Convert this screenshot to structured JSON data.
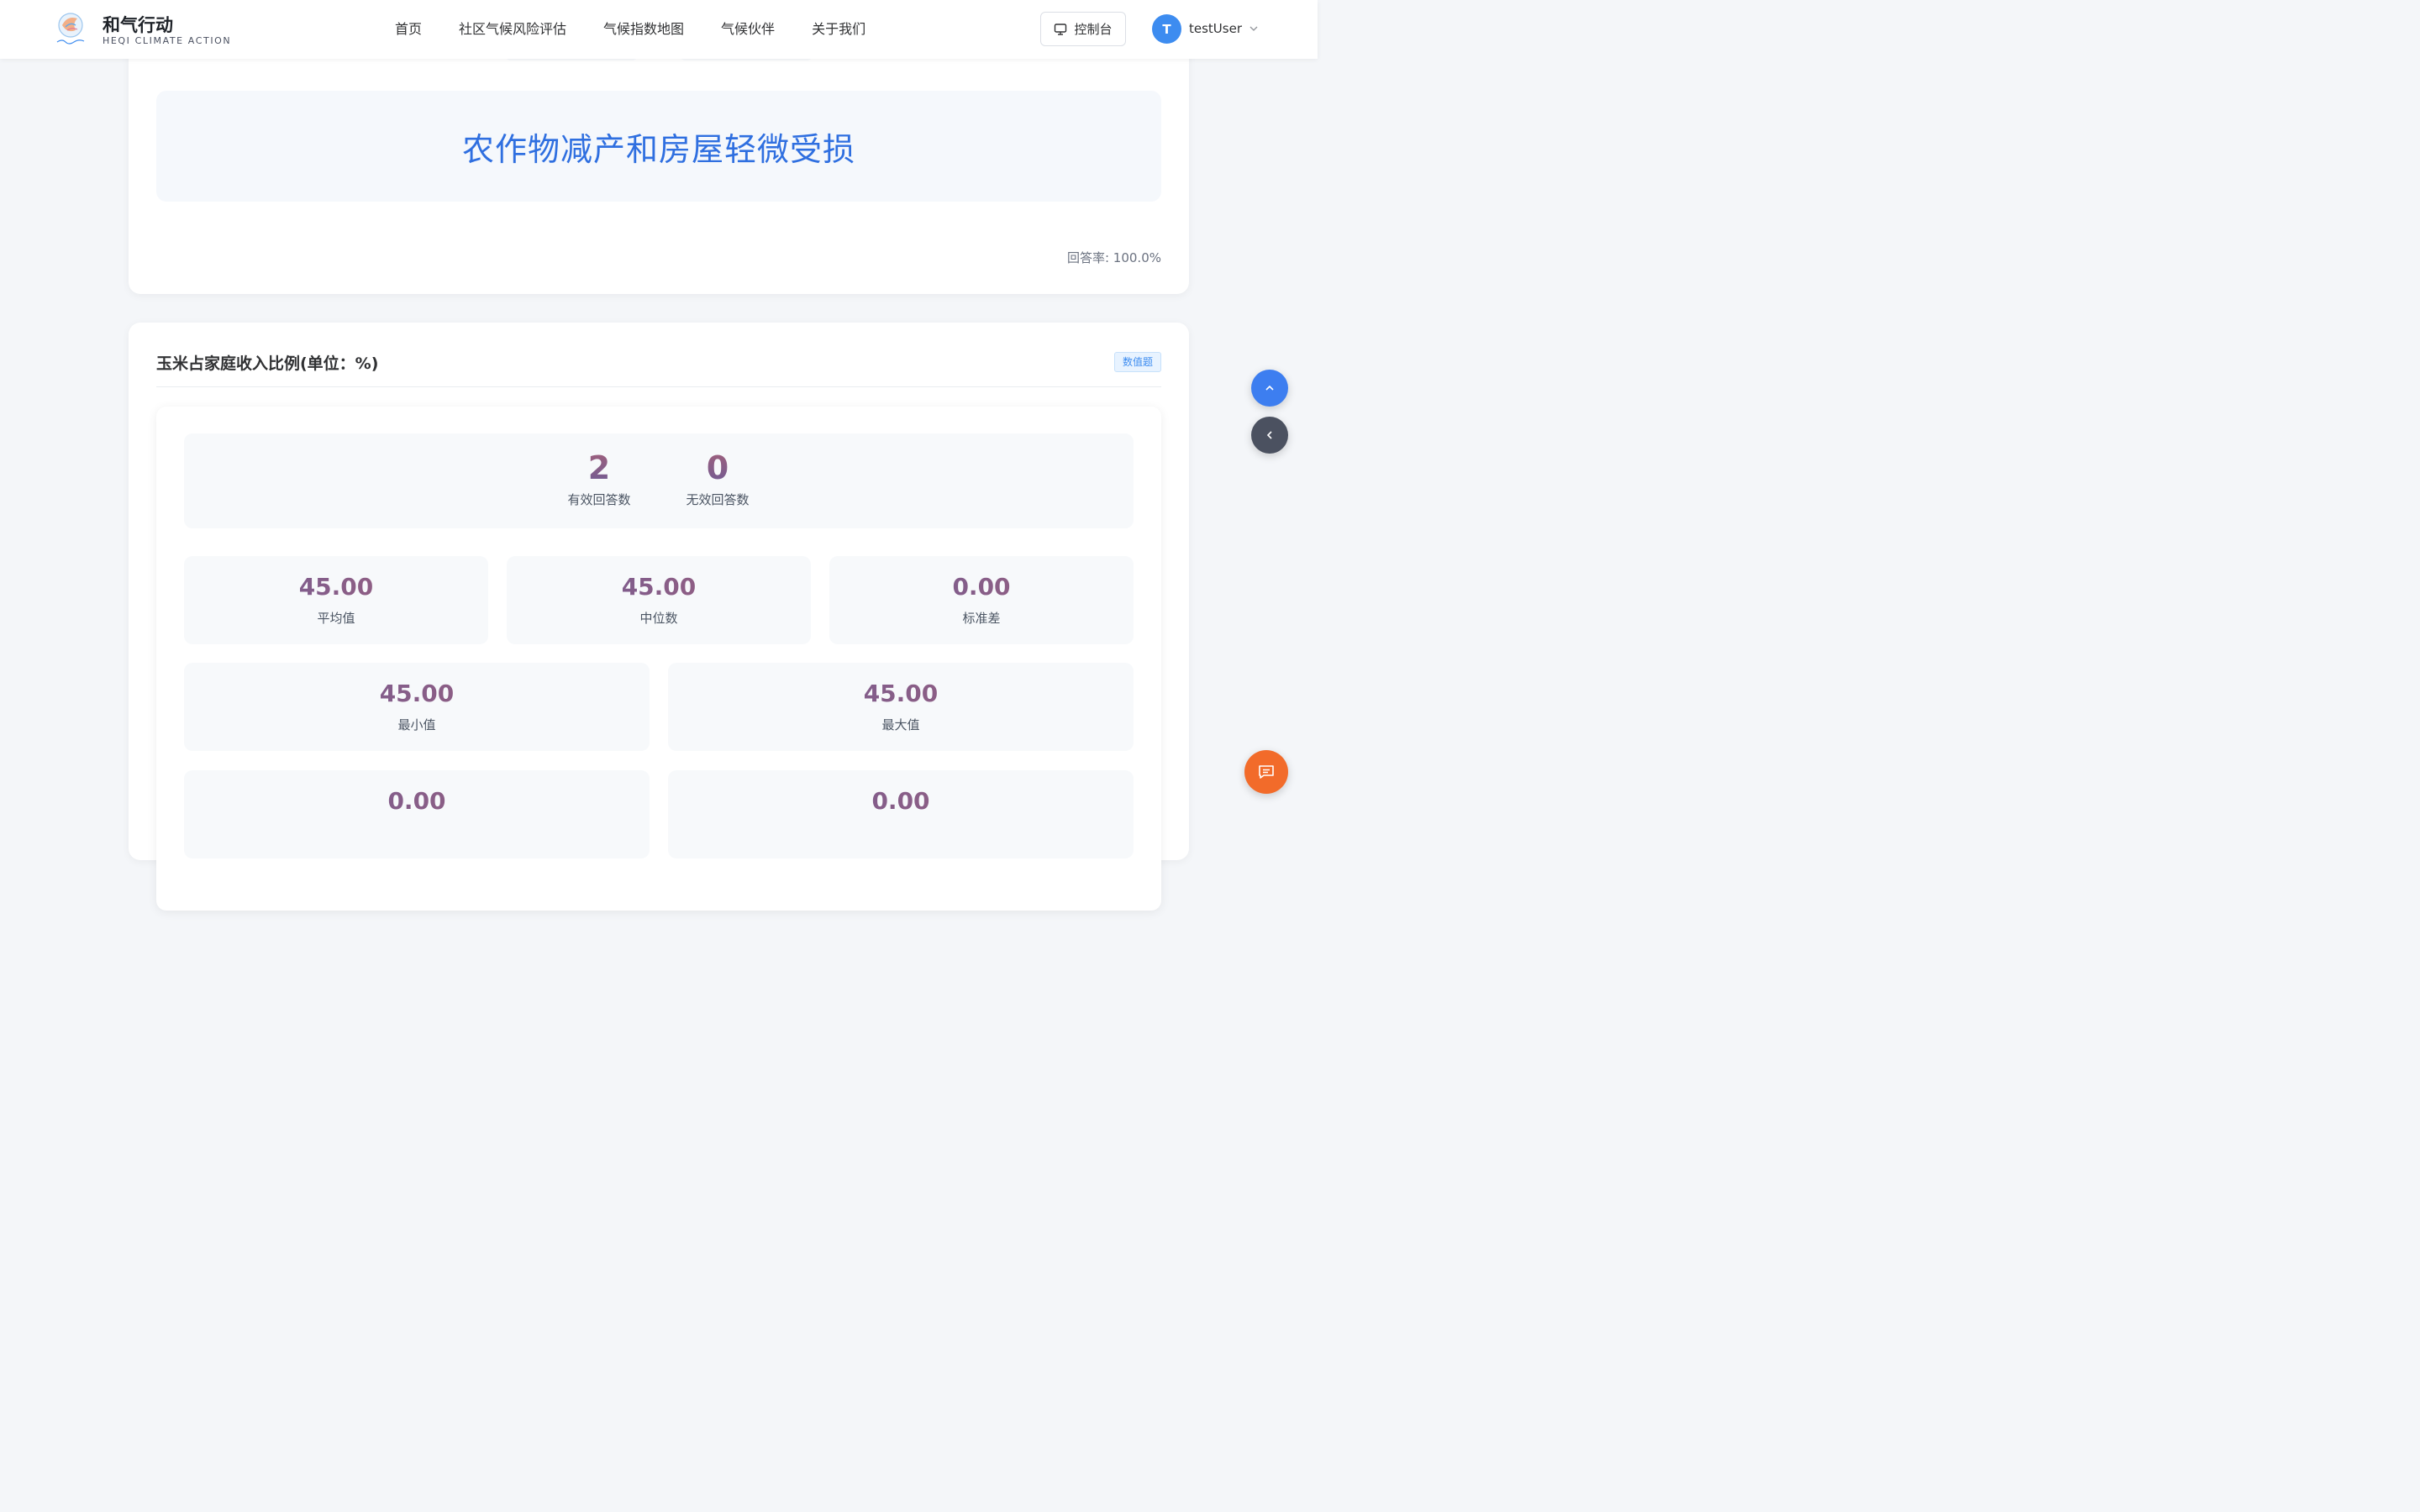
{
  "header": {
    "brand_name": "和气行动",
    "brand_sub": "HEQI CLIMATE ACTION",
    "nav": [
      "首页",
      "社区气候风险评估",
      "气候指数地图",
      "气候伙伴",
      "关于我们"
    ],
    "console_label": "控制台",
    "avatar_initial": "T",
    "username": "testUser"
  },
  "top_card": {
    "answer": "农作物减产和房屋轻微受损",
    "response_rate": "回答率: 100.0%"
  },
  "question_card": {
    "title": "玉米占家庭收入比例(单位：%)",
    "tag": "数值题",
    "counts": [
      {
        "value": "2",
        "label": "有效回答数"
      },
      {
        "value": "0",
        "label": "无效回答数"
      }
    ],
    "stats_row1": [
      {
        "value": "45.00",
        "label": "平均值"
      },
      {
        "value": "45.00",
        "label": "中位数"
      },
      {
        "value": "0.00",
        "label": "标准差"
      }
    ],
    "stats_row2": [
      {
        "value": "45.00",
        "label": "最小值"
      },
      {
        "value": "45.00",
        "label": "最大值"
      }
    ],
    "stats_row3": [
      {
        "value": "0.00"
      },
      {
        "value": "0.00"
      }
    ]
  },
  "colors": {
    "accent": "#3d8cf0",
    "answer_text": "#2f6fe0",
    "chat_button": "#f26b2a",
    "back_button": "#4b5160"
  }
}
